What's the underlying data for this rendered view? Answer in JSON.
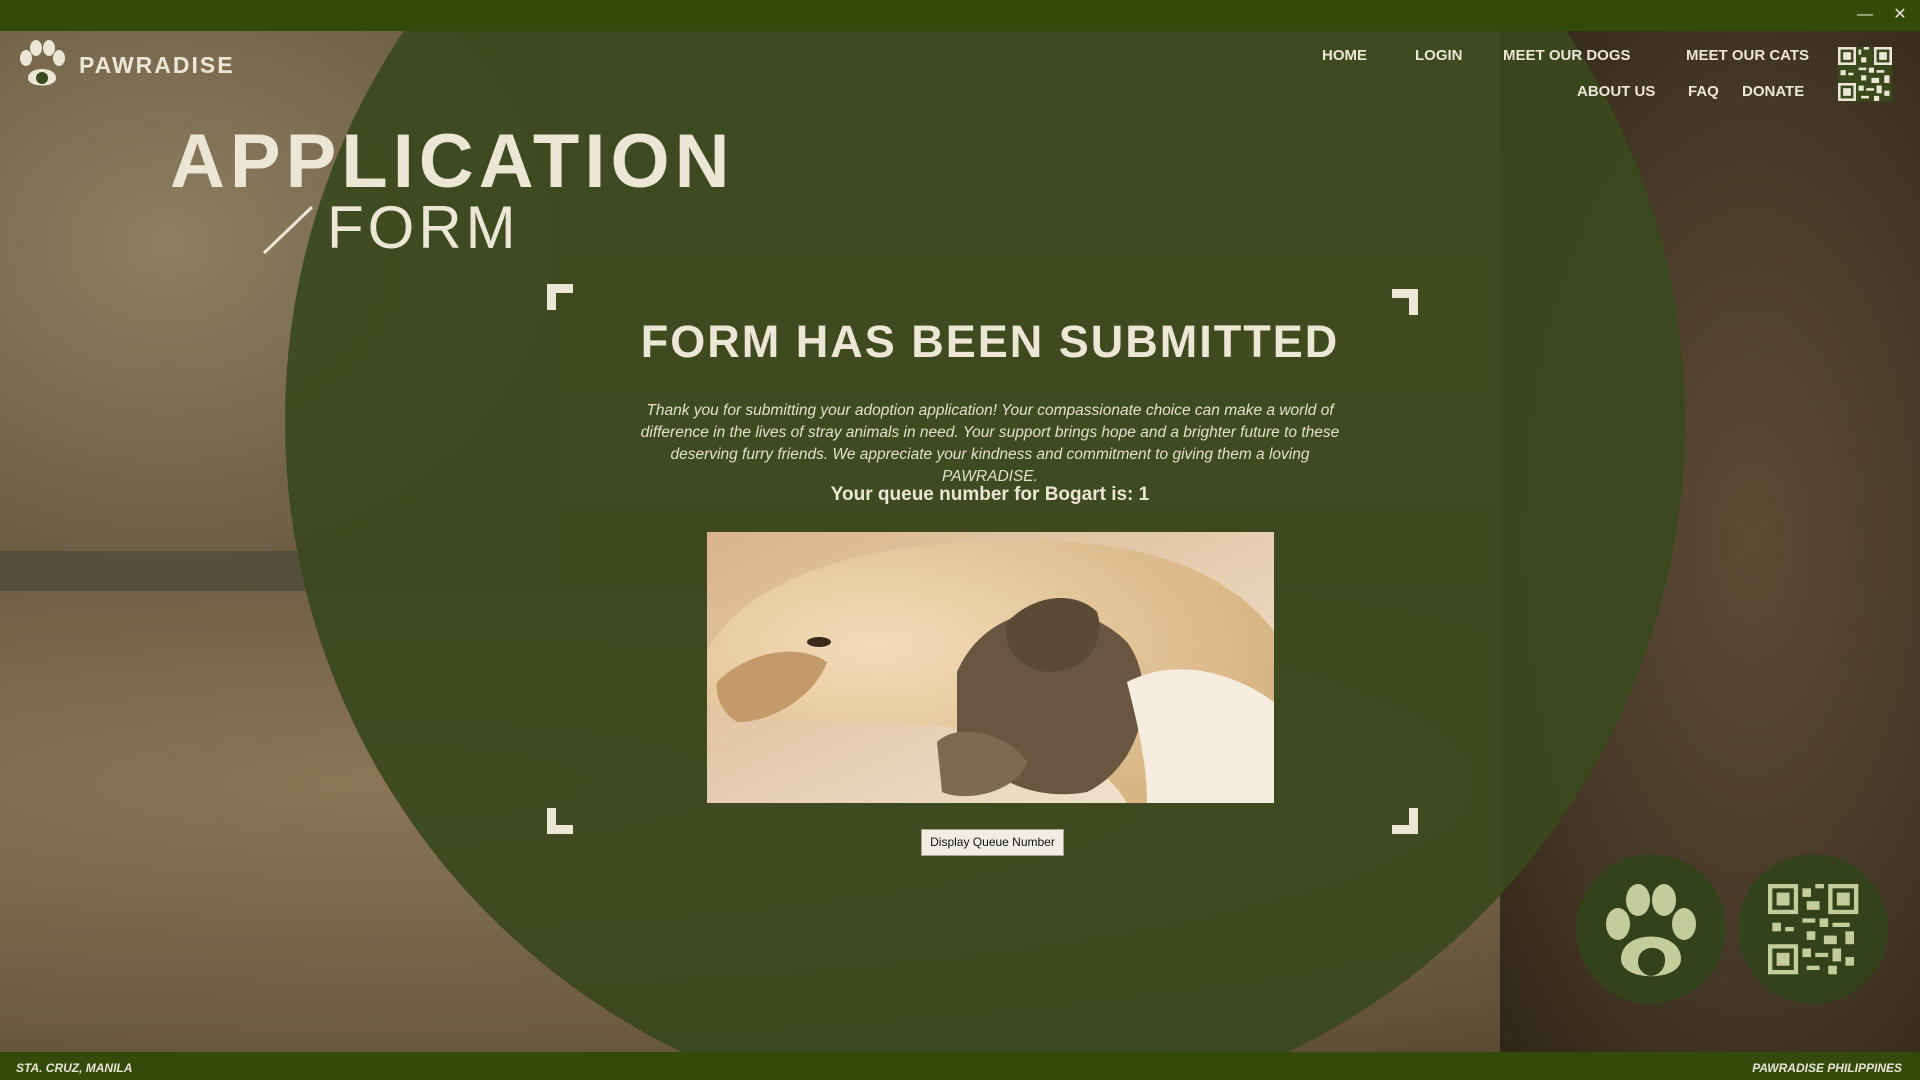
{
  "window": {
    "minimize_glyph": "—",
    "close_glyph": "✕"
  },
  "brand": {
    "name": "PAWRADISE"
  },
  "nav": {
    "home": "HOME",
    "login": "LOGIN",
    "meet_dogs": "MEET OUR DOGS",
    "meet_cats": "MEET OUR CATS",
    "about": "ABOUT US",
    "faq": "FAQ",
    "donate": "DONATE"
  },
  "page": {
    "title_main": "APPLICATION",
    "title_sub": "FORM"
  },
  "content": {
    "heading": "FORM HAS BEEN SUBMITTED",
    "message": "Thank you for submitting your adoption application! Your compassionate choice can make a world of difference in the lives of stray animals in need. Your support brings hope and a brighter future to these deserving furry friends. We appreciate your kindness and commitment to giving them a loving PAWRADISE.",
    "queue_text": "Your queue number for Bogart is: 1",
    "button_label": "Display Queue Number"
  },
  "footer": {
    "left": "STA. CRUZ, MANILA",
    "right": "PAWRADISE PHILIPPINES"
  },
  "colors": {
    "bar": "#344a0b",
    "circle": "#3a481c",
    "text_light": "#ece6d6"
  }
}
